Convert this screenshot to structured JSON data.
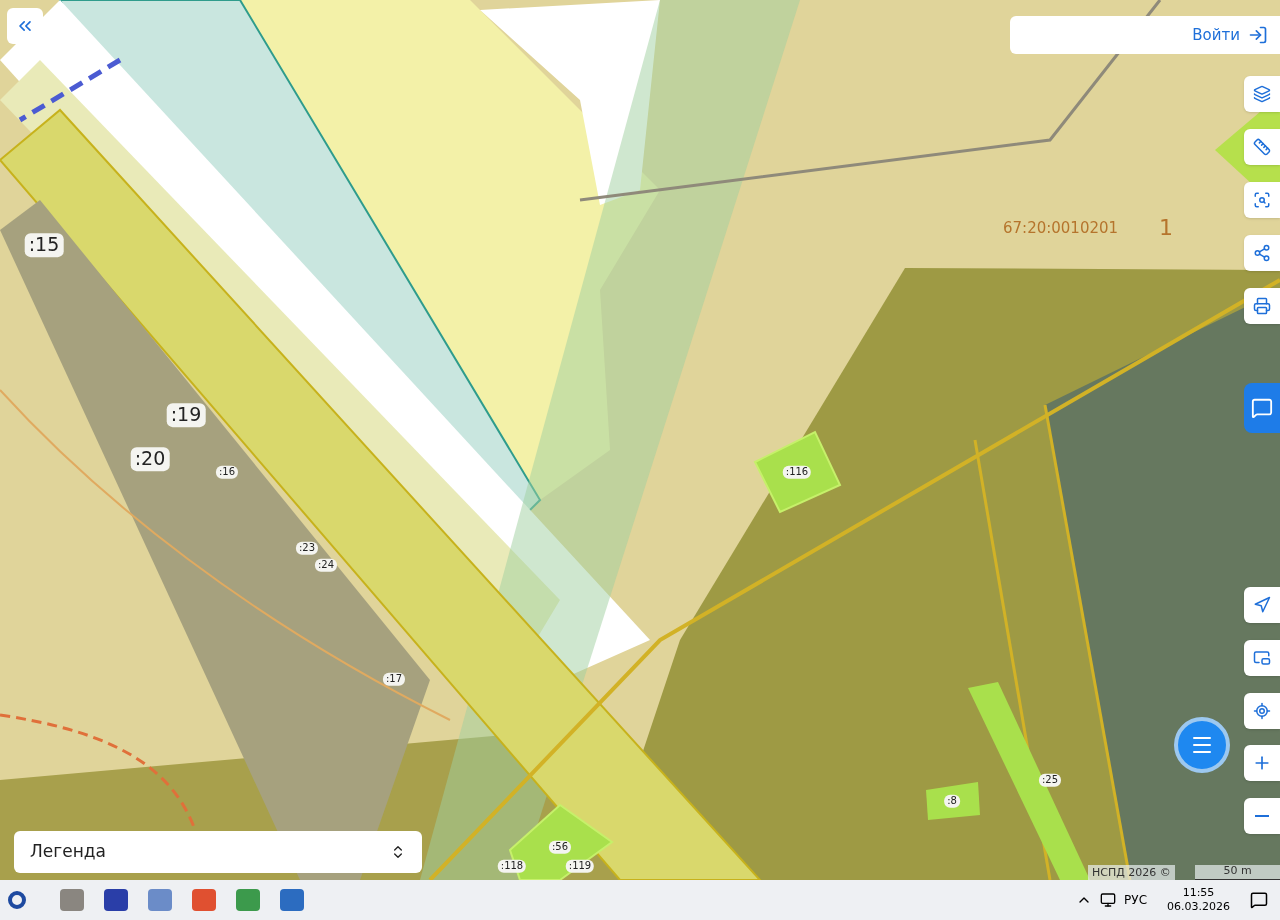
{
  "map": {
    "block_number": "67:20:0010201",
    "zone_label": "1",
    "parcels": [
      {
        "label": ":15",
        "kind": "large"
      },
      {
        "label": ":19",
        "kind": "large"
      },
      {
        "label": ":20",
        "kind": "large"
      },
      {
        "label": ":16",
        "kind": "small"
      },
      {
        "label": ":23",
        "kind": "small"
      },
      {
        "label": ":24",
        "kind": "small"
      },
      {
        "label": ":17",
        "kind": "small"
      },
      {
        "label": ":116",
        "kind": "small"
      },
      {
        "label": ":25",
        "kind": "small"
      },
      {
        "label": ":8",
        "kind": "small"
      },
      {
        "label": ":56",
        "kind": "small"
      },
      {
        "label": ":118",
        "kind": "small"
      },
      {
        "label": ":119",
        "kind": "small"
      }
    ]
  },
  "login_button": {
    "label": "Войти"
  },
  "legend": {
    "label": "Легенда",
    "expanded": false
  },
  "attribution": "НСПД 2026 ©",
  "scale": "50 m",
  "taskbar": {
    "language": "РУС",
    "time": "11:55",
    "date": "06.03.2026"
  }
}
